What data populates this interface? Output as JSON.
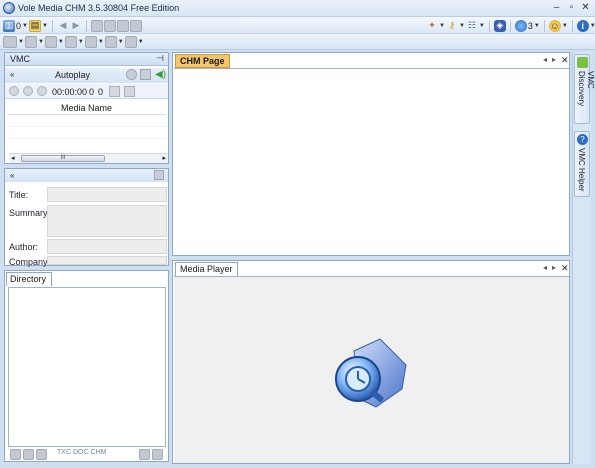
{
  "window": {
    "title": "Vole Media CHM  3.5.30804  Free Edition"
  },
  "toolbar1": {
    "counter_left": "0",
    "globe_count": "3"
  },
  "vmc_panel": {
    "header": "VMC",
    "autoplay_label": "Autoplay",
    "time": "00:00:00",
    "val_a": "0",
    "val_b": "0",
    "column_header": "Media Name",
    "scroll_thumb_glyph": "III"
  },
  "info_panel": {
    "title_label": "Title:",
    "summary_label": "Summary:",
    "author_label": "Author:",
    "company_label": "Company:"
  },
  "directory": {
    "tab_label": "Directory",
    "toolbar_labels": [
      "TXC",
      "DOC",
      "CHM"
    ]
  },
  "chm_page": {
    "tab_label": "CHM Page"
  },
  "media_player": {
    "tab_label": "Media Player"
  },
  "right_rail": {
    "discovery_label": "VMC Discovery",
    "helper_label": "VMC Helper"
  },
  "colors": {
    "accent_tab": "#f7c46e",
    "frame": "#cfdff2",
    "panel_border": "#8fa8c8"
  }
}
